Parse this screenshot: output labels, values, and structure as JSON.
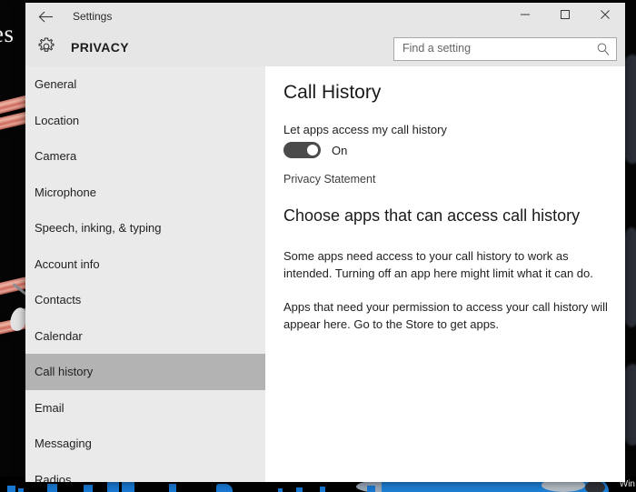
{
  "desktop": {
    "wallpaper_text": "es",
    "taskbar_label": "Win",
    "background_color": "#050505",
    "accent_color": "#1878d2"
  },
  "window": {
    "titlebar": {
      "back_icon": "back-arrow-icon",
      "title": "Settings",
      "minimize_icon": "minimize-icon",
      "maximize_icon": "maximize-icon",
      "close_icon": "close-icon"
    },
    "header": {
      "gear_icon": "gear-icon",
      "page_title": "PRIVACY",
      "search": {
        "placeholder": "Find a setting",
        "value": "",
        "icon": "search-icon"
      }
    }
  },
  "sidebar": {
    "selected": "Call history",
    "items": [
      {
        "label": "General"
      },
      {
        "label": "Location"
      },
      {
        "label": "Camera"
      },
      {
        "label": "Microphone"
      },
      {
        "label": "Speech, inking, & typing"
      },
      {
        "label": "Account info"
      },
      {
        "label": "Contacts"
      },
      {
        "label": "Calendar"
      },
      {
        "label": "Call history"
      },
      {
        "label": "Email"
      },
      {
        "label": "Messaging"
      },
      {
        "label": "Radios"
      }
    ]
  },
  "content": {
    "heading": "Call History",
    "setting_label": "Let apps access my call history",
    "toggle": {
      "state_label": "On",
      "checked": true,
      "color": "#4b4b4b"
    },
    "privacy_link": "Privacy Statement",
    "section_heading": "Choose apps that can access call history",
    "paragraph_1": "Some apps need access to your call history to work as intended. Turning off an app here might limit what it can do.",
    "paragraph_2": "Apps that need your permission to access your call history will appear here. Go to the Store to get apps."
  }
}
